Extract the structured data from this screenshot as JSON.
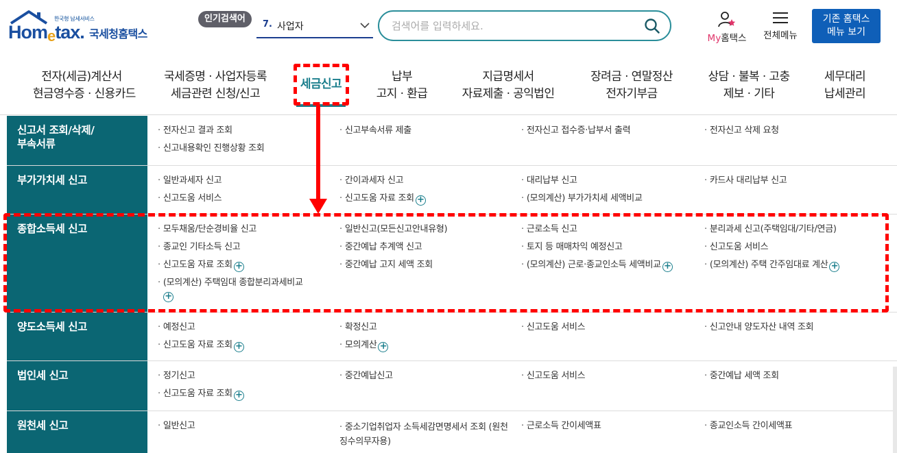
{
  "header": {
    "logo": {
      "small_text": "한국형 납세서비스",
      "brand": "Hom",
      "brand_e": "e",
      "brand_rest": "tax.",
      "korean": "국세청홈택스"
    },
    "popular_search": {
      "badge": "인기검색어",
      "rank": "7.",
      "keyword": "사업자"
    },
    "search": {
      "placeholder": "검색어를 입력하세요."
    },
    "my_hometax": {
      "my": "My",
      "label": "홈택스"
    },
    "all_menu": {
      "label": "전체메뉴"
    },
    "old_menu_button": {
      "line1": "기존 홈택스",
      "line2": "메뉴 보기"
    }
  },
  "gnb": [
    {
      "line1": "전자(세금)계산서",
      "line2": "현금영수증 · 신용카드"
    },
    {
      "line1": "국세증명 · 사업자등록",
      "line2": "세금관련 신청/신고"
    },
    {
      "line1": "세금신고",
      "line2": ""
    },
    {
      "line1": "납부",
      "line2": "고지 · 환급"
    },
    {
      "line1": "지급명세서",
      "line2": "자료제출 · 공익법인"
    },
    {
      "line1": "장려금 · 연말정산",
      "line2": "전자기부금"
    },
    {
      "line1": "상담 · 불복 · 고충",
      "line2": "제보 · 기타"
    },
    {
      "line1": "세무대리",
      "line2": "납세관리"
    }
  ],
  "menu_rows": [
    {
      "category_line1": "신고서 조회/삭제/",
      "category_line2": "부속서류",
      "items": [
        "전자신고 결과 조회",
        "신고부속서류 제출",
        "전자신고 접수증·납부서 출력",
        "전자신고 삭제 요청",
        "신고내용확인 진행상황 조회"
      ]
    },
    {
      "category_line1": "부가가치세 신고",
      "items": [
        "일반과세자 신고",
        "간이과세자 신고",
        "대리납부 신고",
        "카드사 대리납부 신고",
        "신고도움 서비스",
        "신고도움 자료 조회",
        "(모의계산) 부가가치세 세액비교"
      ]
    },
    {
      "category_line1": "종합소득세 신고",
      "items": [
        "모두채움/단순경비율 신고",
        "일반신고(모든신고안내유형)",
        "근로소득 신고",
        "분리과세 신고(주택임대/기타/연금)",
        "종교인 기타소득 신고",
        "중간예납 추계액 신고",
        "토지 등 매매차익 예정신고",
        "신고도움 서비스",
        "신고도움 자료 조회",
        "중간예납 고지 세액 조회",
        "(모의계산) 근로·종교인소득 세액비교",
        "(모의계산) 주택 간주임대료 계산",
        "(모의계산) 주택임대 종합분리과세비교"
      ]
    },
    {
      "category_line1": "양도소득세 신고",
      "items": [
        "예정신고",
        "확정신고",
        "신고도움 서비스",
        "신고안내 양도자산 내역 조회",
        "신고도움 자료 조회",
        "모의계산"
      ]
    },
    {
      "category_line1": "법인세 신고",
      "items": [
        "정기신고",
        "중간예납신고",
        "신고도움 서비스",
        "중간예납 세액 조회",
        "신고도움 자료 조회"
      ]
    },
    {
      "category_line1": "원천세 신고",
      "items": [
        "일반신고",
        "중소기업취업자 소득세감면명세서 조회 (원천징수의무자용)",
        "근로소득 간이세액표",
        "종교인소득 간이세액표"
      ]
    }
  ],
  "plus_symbol": "+",
  "colors": {
    "teal": "#0b6673",
    "accent": "#1a7e8c",
    "brand_blue": "#1a4fa0",
    "button_blue": "#0f5fb8",
    "annotation_red": "#ff0000"
  }
}
